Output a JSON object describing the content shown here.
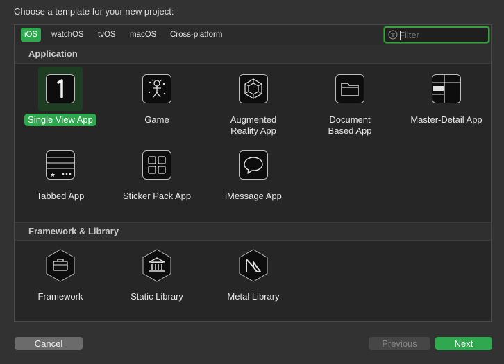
{
  "prompt": "Choose a template for your new project:",
  "tabs": [
    {
      "label": "iOS",
      "active": true
    },
    {
      "label": "watchOS",
      "active": false
    },
    {
      "label": "tvOS",
      "active": false
    },
    {
      "label": "macOS",
      "active": false
    },
    {
      "label": "Cross-platform",
      "active": false
    }
  ],
  "filter": {
    "placeholder": "Filter",
    "value": ""
  },
  "sections": [
    {
      "title": "Application",
      "templates": [
        {
          "label": "Single View App",
          "icon": "single-view-app-icon",
          "selected": true
        },
        {
          "label": "Game",
          "icon": "game-icon",
          "selected": false
        },
        {
          "label": "Augmented Reality App",
          "icon": "augmented-reality-icon",
          "selected": false
        },
        {
          "label": "Document Based App",
          "icon": "document-based-icon",
          "selected": false
        },
        {
          "label": "Master-Detail App",
          "icon": "master-detail-icon",
          "selected": false
        },
        {
          "label": "Tabbed App",
          "icon": "tabbed-app-icon",
          "selected": false
        },
        {
          "label": "Sticker Pack App",
          "icon": "sticker-pack-icon",
          "selected": false
        },
        {
          "label": "iMessage App",
          "icon": "imessage-icon",
          "selected": false
        }
      ]
    },
    {
      "title": "Framework & Library",
      "templates": [
        {
          "label": "Framework",
          "icon": "framework-icon",
          "selected": false
        },
        {
          "label": "Static Library",
          "icon": "static-library-icon",
          "selected": false
        },
        {
          "label": "Metal Library",
          "icon": "metal-library-icon",
          "selected": false
        }
      ]
    }
  ],
  "buttons": {
    "cancel": "Cancel",
    "previous": "Previous",
    "next": "Next"
  },
  "colors": {
    "accent": "#2fa84f",
    "background": "#323232",
    "panel": "#262626"
  }
}
